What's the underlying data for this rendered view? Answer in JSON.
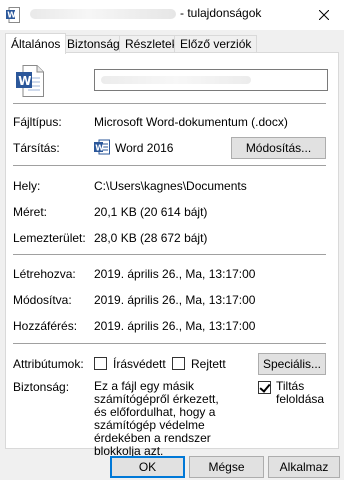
{
  "window": {
    "title": "- tulajdonságok",
    "close_icon": "close-icon"
  },
  "tabs": [
    "Általános",
    "Biztonság",
    "Részletek",
    "Előző verziók"
  ],
  "general": {
    "file_type_label": "Fájltípus:",
    "file_type_value": "Microsoft Word-dokumentum (.docx)",
    "opens_with_label": "Társítás:",
    "opens_with_value": "Word 2016",
    "change_button": "Módosítás...",
    "location_label": "Hely:",
    "location_value": "C:\\Users\\kagnes\\Documents",
    "size_label": "Méret:",
    "size_value": "20,1 KB (20 614 bájt)",
    "size_on_disk_label": "Lemezterület:",
    "size_on_disk_value": "28,0 KB (28 672 bájt)",
    "created_label": "Létrehozva:",
    "created_value": "2019. április 26., Ma, 13:17:00",
    "modified_label": "Módosítva:",
    "modified_value": "2019. április 26., Ma, 13:17:00",
    "accessed_label": "Hozzáférés:",
    "accessed_value": "2019. április 26., Ma, 13:17:00",
    "attributes_label": "Attribútumok:",
    "readonly_label": "Írásvédett",
    "readonly_checked": false,
    "hidden_label": "Rejtett",
    "hidden_checked": false,
    "advanced_button": "Speciális...",
    "security_label": "Biztonság:",
    "security_text": "Ez a fájl egy másik számítógépről érkezett, és előfordulhat, hogy a számítógép védelme érdekében a rendszer blokkolja azt.",
    "unblock_label": "Tiltás feloldása",
    "unblock_checked": true
  },
  "footer": {
    "ok": "OK",
    "cancel": "Mégse",
    "apply": "Alkalmaz"
  },
  "colors": {
    "word_blue": "#2b579a",
    "accent": "#0078d7"
  }
}
